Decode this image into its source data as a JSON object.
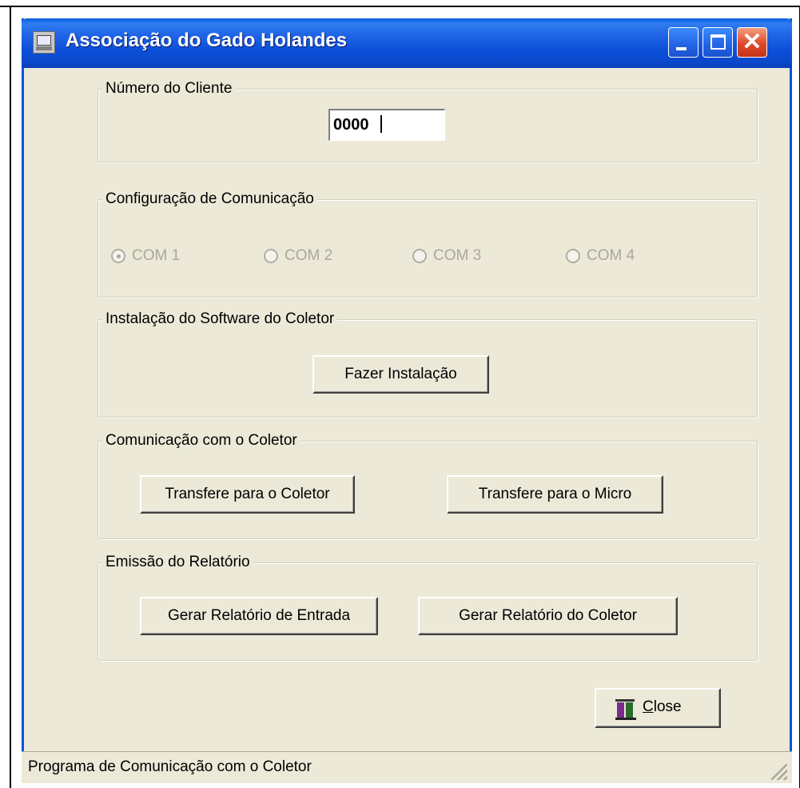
{
  "window": {
    "title": "Associação do Gado Holandes",
    "accent_color": "#0054e3",
    "close_color": "#e0482a"
  },
  "client_group": {
    "legend": "Número do Cliente",
    "input_value": "0000"
  },
  "comm_config": {
    "legend": "Configuração de Comunicação",
    "options": [
      "COM 1",
      "COM 2",
      "COM 3",
      "COM 4"
    ],
    "selected": "COM 1",
    "disabled": true
  },
  "install_group": {
    "legend": "Instalação do Software do Coletor",
    "button_label": "Fazer Instalação"
  },
  "comm_group": {
    "legend": "Comunicação com o Coletor",
    "to_collector_label": "Transfere para o Coletor",
    "to_micro_label": "Transfere para o Micro"
  },
  "report_group": {
    "legend": "Emissão do Relatório",
    "entry_report_label": "Gerar Relatório de Entrada",
    "collector_report_label": "Gerar Relatório do Coletor"
  },
  "close_button": {
    "mnemonic": "C",
    "rest": "lose",
    "icon": "door-exit-icon"
  },
  "statusbar": {
    "text": "Programa de Comunicação com o Coletor"
  }
}
